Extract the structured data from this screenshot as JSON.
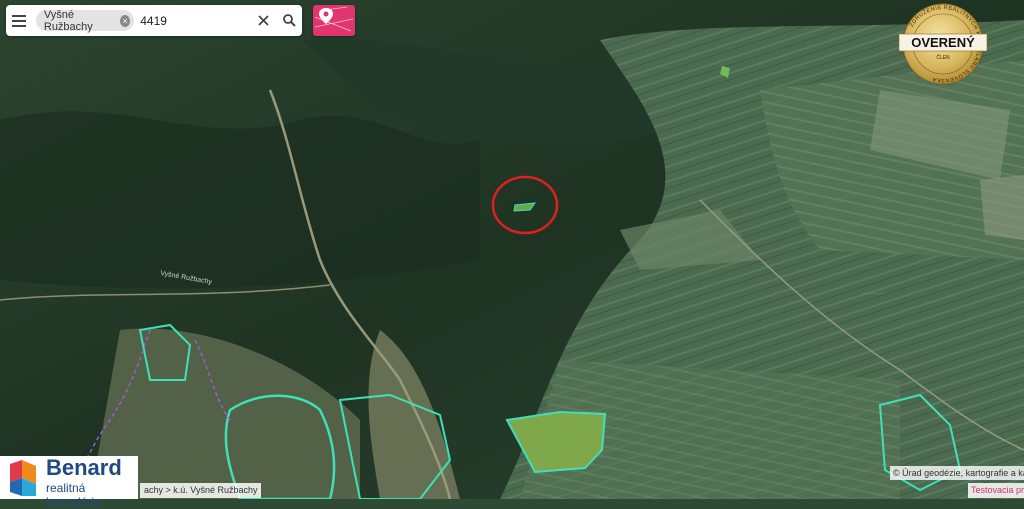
{
  "search": {
    "chip_label": "Vyšné Ružbachy",
    "query": "4419"
  },
  "icons": {
    "menu": "menu-icon",
    "clear": "close-icon",
    "search": "search-icon",
    "cadastre_button": "map-pin-parcel-icon"
  },
  "badge": {
    "ring_text": "ZDRUŽENIE REALITNÝCH KANCELÁRIÍ SLOVENSKA",
    "main": "OVERENÝ",
    "sub": "ČLEN"
  },
  "logo": {
    "title": "Benard",
    "subtitle": "realitná kancelária"
  },
  "map": {
    "place_labels": [
      "Vyšné Ružbachy"
    ],
    "breadcrumb": "achy > k.ú. Vyšné Ružbachy",
    "attribution": "© Úrad geodézie, kartografie a kat",
    "testing_link": "Testovacia pre"
  },
  "colors": {
    "accent_pink": "#e0356f",
    "parcel_outline": "#3fe0b8",
    "selection_circle": "#e02020",
    "logo_blue": "#1f4a83"
  }
}
